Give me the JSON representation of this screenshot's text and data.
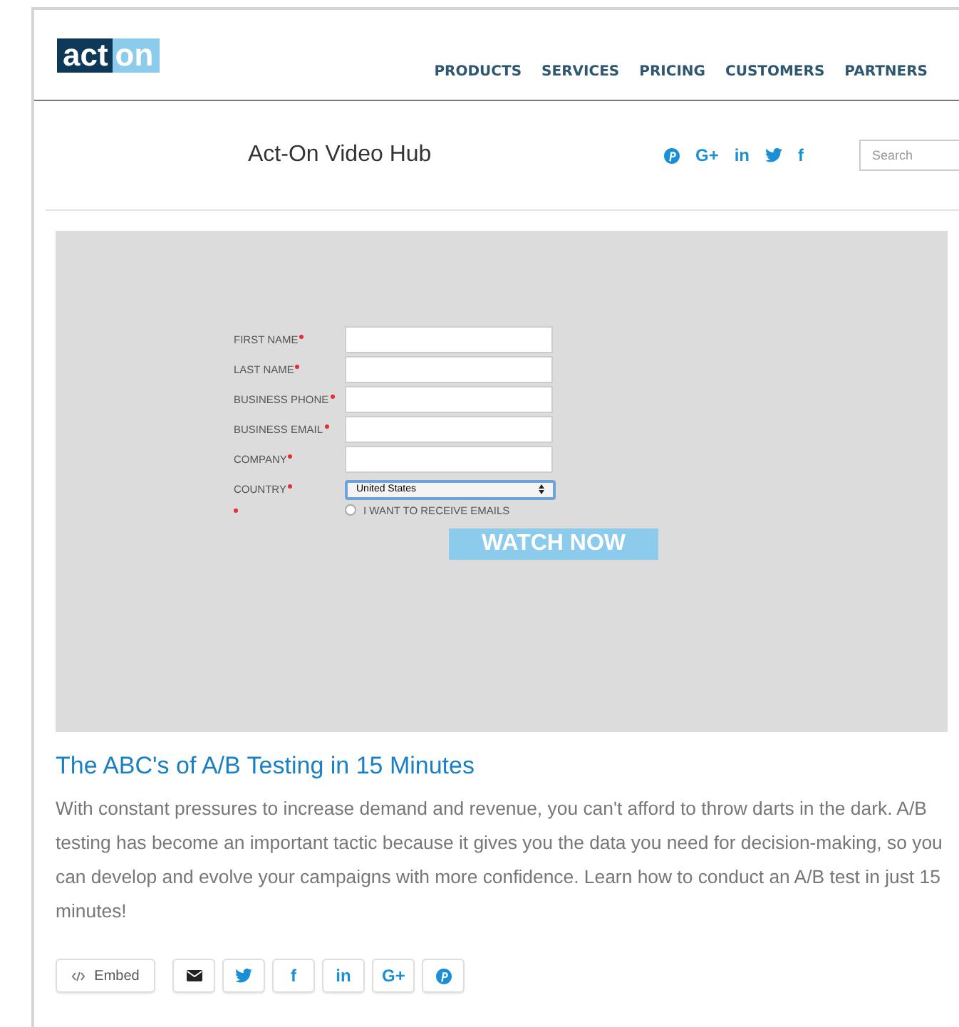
{
  "header": {
    "logo": {
      "left": "act",
      "right": "on"
    },
    "nav": [
      "PRODUCTS",
      "SERVICES",
      "PRICING",
      "CUSTOMERS",
      "PARTNERS"
    ]
  },
  "hub": {
    "title": "Act-On Video Hub",
    "social": [
      {
        "kind": "pinterest"
      },
      {
        "kind": "text",
        "glyph": "G+"
      },
      {
        "kind": "text",
        "glyph": "in"
      },
      {
        "kind": "twitter"
      },
      {
        "kind": "text",
        "glyph": "f"
      }
    ],
    "search": {
      "placeholder": "Search"
    }
  },
  "form": {
    "fields": [
      {
        "label": "FIRST NAME",
        "required": true,
        "kind": "text"
      },
      {
        "label": "LAST NAME",
        "required": true,
        "kind": "text"
      },
      {
        "label": "BUSINESS PHONE",
        "required": true,
        "kind": "text"
      },
      {
        "label": "BUSINESS EMAIL",
        "required": true,
        "kind": "text"
      },
      {
        "label": "COMPANY",
        "required": true,
        "kind": "text"
      },
      {
        "label": "COUNTRY",
        "required": true,
        "kind": "select",
        "value": "United States"
      }
    ],
    "optin": {
      "label": "I WANT TO RECEIVE EMAILS",
      "required": true,
      "checked": false
    },
    "submit": "WATCH NOW"
  },
  "video": {
    "title": "The ABC's of A/B Testing in 15 Minutes",
    "description": "With constant pressures to increase demand and revenue, you can't afford to throw darts in the dark. A/B testing has become an important tactic because it gives you the data you need for decision-making, so you can develop and evolve your campaigns with more confidence. Learn how to conduct an A/B test in just 15 minutes!"
  },
  "share": {
    "embed": "Embed",
    "buttons": [
      {
        "kind": "email"
      },
      {
        "kind": "twitter"
      },
      {
        "kind": "text",
        "glyph": "f"
      },
      {
        "kind": "text",
        "glyph": "in"
      },
      {
        "kind": "text",
        "glyph": "G+"
      },
      {
        "kind": "pinterest"
      }
    ]
  }
}
